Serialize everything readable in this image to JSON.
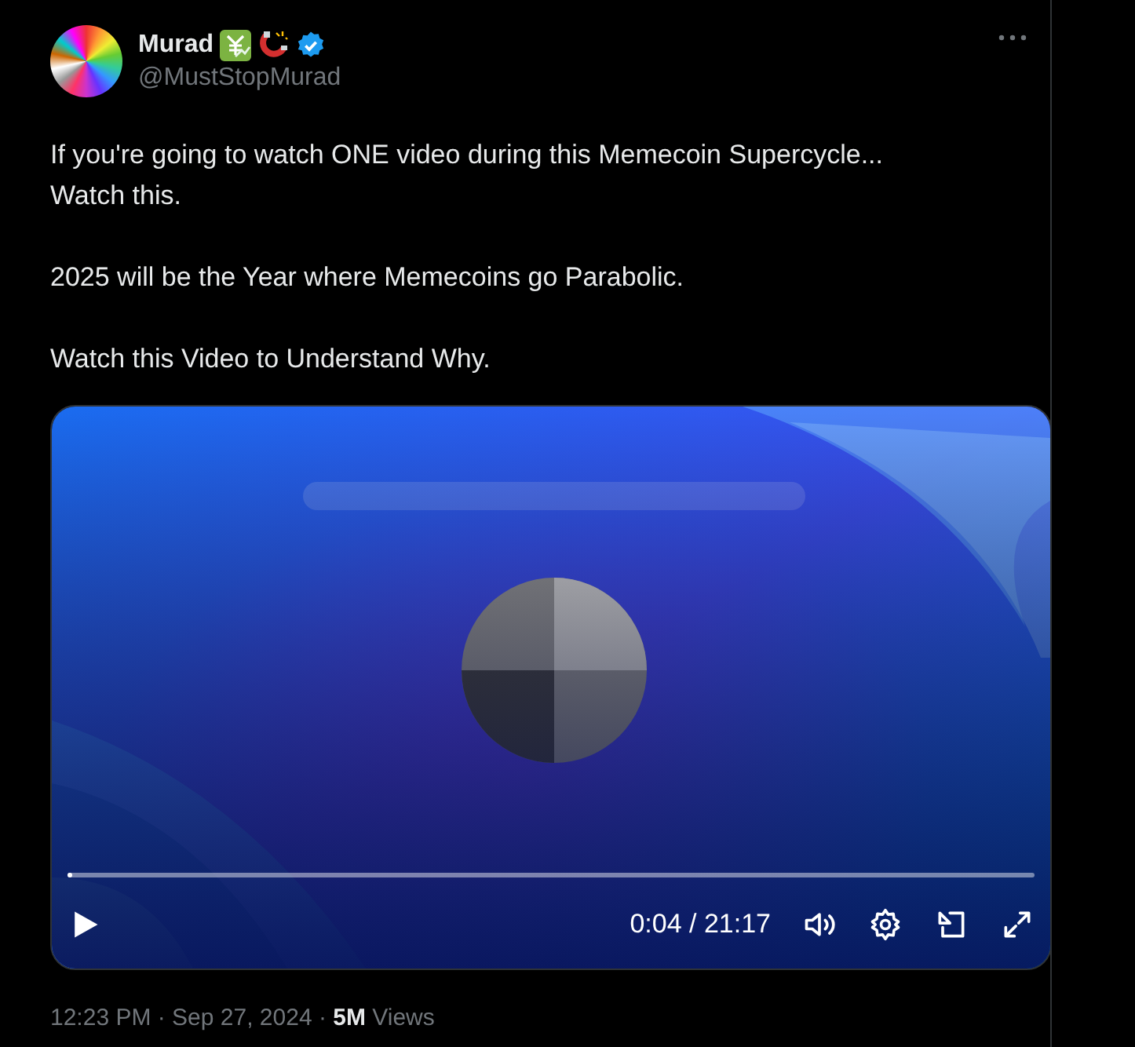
{
  "author": {
    "name": "Murad",
    "handle": "@MustStopMurad",
    "verified": true
  },
  "paragraphs": [
    "If you're going to watch ONE video during this Memecoin Supercycle...\nWatch this.",
    "2025 will be the Year where Memecoins go Parabolic.",
    "Watch this Video to Understand Why."
  ],
  "video": {
    "kind": "picture",
    "playing": false,
    "level": 0.003,
    "time": "0:04 / 21:17"
  },
  "footer": "12:23 PM · Sep 27, 2024 · **5M** Views"
}
